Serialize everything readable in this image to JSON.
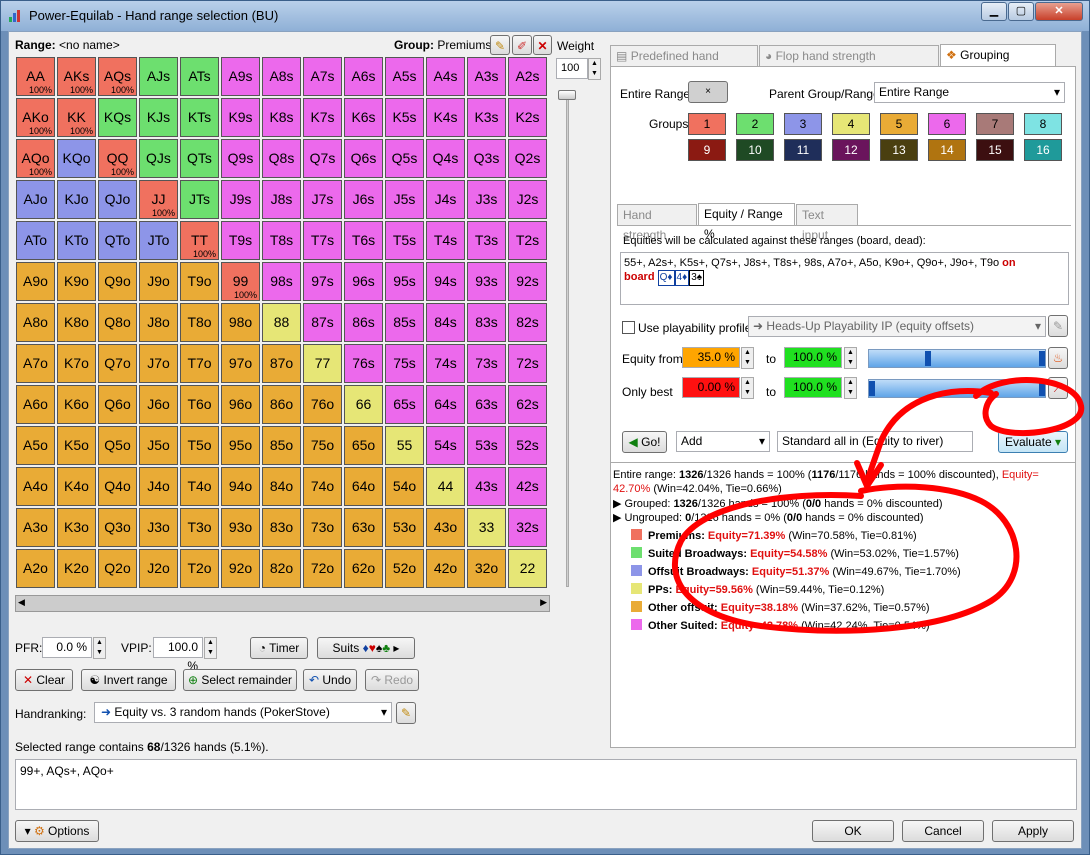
{
  "window": {
    "title": "Power-Equilab - Hand range selection (BU)"
  },
  "left": {
    "range_label": "Range:",
    "range_name": "<no name>",
    "group_label": "Group:",
    "group_name": "Premiums",
    "weight_label": "Weight",
    "weight_value": "100",
    "grid": [
      [
        [
          "AA",
          "1",
          "100%"
        ],
        [
          "AKs",
          "1",
          "100%"
        ],
        [
          "AQs",
          "1",
          "100%"
        ],
        [
          "AJs",
          "2",
          ""
        ],
        [
          "ATs",
          "2",
          ""
        ],
        [
          "A9s",
          "6",
          ""
        ],
        [
          "A8s",
          "6",
          ""
        ],
        [
          "A7s",
          "6",
          ""
        ],
        [
          "A6s",
          "6",
          ""
        ],
        [
          "A5s",
          "6",
          ""
        ],
        [
          "A4s",
          "6",
          ""
        ],
        [
          "A3s",
          "6",
          ""
        ],
        [
          "A2s",
          "6",
          ""
        ]
      ],
      [
        [
          "AKo",
          "1",
          "100%"
        ],
        [
          "KK",
          "1",
          "100%"
        ],
        [
          "KQs",
          "2",
          ""
        ],
        [
          "KJs",
          "2",
          ""
        ],
        [
          "KTs",
          "2",
          ""
        ],
        [
          "K9s",
          "6",
          ""
        ],
        [
          "K8s",
          "6",
          ""
        ],
        [
          "K7s",
          "6",
          ""
        ],
        [
          "K6s",
          "6",
          ""
        ],
        [
          "K5s",
          "6",
          ""
        ],
        [
          "K4s",
          "6",
          ""
        ],
        [
          "K3s",
          "6",
          ""
        ],
        [
          "K2s",
          "6",
          ""
        ]
      ],
      [
        [
          "AQo",
          "1",
          "100%"
        ],
        [
          "KQo",
          "3",
          ""
        ],
        [
          "QQ",
          "1",
          "100%"
        ],
        [
          "QJs",
          "2",
          ""
        ],
        [
          "QTs",
          "2",
          ""
        ],
        [
          "Q9s",
          "6",
          ""
        ],
        [
          "Q8s",
          "6",
          ""
        ],
        [
          "Q7s",
          "6",
          ""
        ],
        [
          "Q6s",
          "6",
          ""
        ],
        [
          "Q5s",
          "6",
          ""
        ],
        [
          "Q4s",
          "6",
          ""
        ],
        [
          "Q3s",
          "6",
          ""
        ],
        [
          "Q2s",
          "6",
          ""
        ]
      ],
      [
        [
          "AJo",
          "3",
          ""
        ],
        [
          "KJo",
          "3",
          ""
        ],
        [
          "QJo",
          "3",
          ""
        ],
        [
          "JJ",
          "1",
          "100%"
        ],
        [
          "JTs",
          "2",
          ""
        ],
        [
          "J9s",
          "6",
          ""
        ],
        [
          "J8s",
          "6",
          ""
        ],
        [
          "J7s",
          "6",
          ""
        ],
        [
          "J6s",
          "6",
          ""
        ],
        [
          "J5s",
          "6",
          ""
        ],
        [
          "J4s",
          "6",
          ""
        ],
        [
          "J3s",
          "6",
          ""
        ],
        [
          "J2s",
          "6",
          ""
        ]
      ],
      [
        [
          "ATo",
          "3",
          ""
        ],
        [
          "KTo",
          "3",
          ""
        ],
        [
          "QTo",
          "3",
          ""
        ],
        [
          "JTo",
          "3",
          ""
        ],
        [
          "TT",
          "1",
          "100%"
        ],
        [
          "T9s",
          "6",
          ""
        ],
        [
          "T8s",
          "6",
          ""
        ],
        [
          "T7s",
          "6",
          ""
        ],
        [
          "T6s",
          "6",
          ""
        ],
        [
          "T5s",
          "6",
          ""
        ],
        [
          "T4s",
          "6",
          ""
        ],
        [
          "T3s",
          "6",
          ""
        ],
        [
          "T2s",
          "6",
          ""
        ]
      ],
      [
        [
          "A9o",
          "5",
          ""
        ],
        [
          "K9o",
          "5",
          ""
        ],
        [
          "Q9o",
          "5",
          ""
        ],
        [
          "J9o",
          "5",
          ""
        ],
        [
          "T9o",
          "5",
          ""
        ],
        [
          "99",
          "1",
          "100%"
        ],
        [
          "98s",
          "6",
          ""
        ],
        [
          "97s",
          "6",
          ""
        ],
        [
          "96s",
          "6",
          ""
        ],
        [
          "95s",
          "6",
          ""
        ],
        [
          "94s",
          "6",
          ""
        ],
        [
          "93s",
          "6",
          ""
        ],
        [
          "92s",
          "6",
          ""
        ]
      ],
      [
        [
          "A8o",
          "5",
          ""
        ],
        [
          "K8o",
          "5",
          ""
        ],
        [
          "Q8o",
          "5",
          ""
        ],
        [
          "J8o",
          "5",
          ""
        ],
        [
          "T8o",
          "5",
          ""
        ],
        [
          "98o",
          "5",
          ""
        ],
        [
          "88",
          "4",
          ""
        ],
        [
          "87s",
          "6",
          ""
        ],
        [
          "86s",
          "6",
          ""
        ],
        [
          "85s",
          "6",
          ""
        ],
        [
          "84s",
          "6",
          ""
        ],
        [
          "83s",
          "6",
          ""
        ],
        [
          "82s",
          "6",
          ""
        ]
      ],
      [
        [
          "A7o",
          "5",
          ""
        ],
        [
          "K7o",
          "5",
          ""
        ],
        [
          "Q7o",
          "5",
          ""
        ],
        [
          "J7o",
          "5",
          ""
        ],
        [
          "T7o",
          "5",
          ""
        ],
        [
          "97o",
          "5",
          ""
        ],
        [
          "87o",
          "5",
          ""
        ],
        [
          "77",
          "4",
          ""
        ],
        [
          "76s",
          "6",
          ""
        ],
        [
          "75s",
          "6",
          ""
        ],
        [
          "74s",
          "6",
          ""
        ],
        [
          "73s",
          "6",
          ""
        ],
        [
          "72s",
          "6",
          ""
        ]
      ],
      [
        [
          "A6o",
          "5",
          ""
        ],
        [
          "K6o",
          "5",
          ""
        ],
        [
          "Q6o",
          "5",
          ""
        ],
        [
          "J6o",
          "5",
          ""
        ],
        [
          "T6o",
          "5",
          ""
        ],
        [
          "96o",
          "5",
          ""
        ],
        [
          "86o",
          "5",
          ""
        ],
        [
          "76o",
          "5",
          ""
        ],
        [
          "66",
          "4",
          ""
        ],
        [
          "65s",
          "6",
          ""
        ],
        [
          "64s",
          "6",
          ""
        ],
        [
          "63s",
          "6",
          ""
        ],
        [
          "62s",
          "6",
          ""
        ]
      ],
      [
        [
          "A5o",
          "5",
          ""
        ],
        [
          "K5o",
          "5",
          ""
        ],
        [
          "Q5o",
          "5",
          ""
        ],
        [
          "J5o",
          "5",
          ""
        ],
        [
          "T5o",
          "5",
          ""
        ],
        [
          "95o",
          "5",
          ""
        ],
        [
          "85o",
          "5",
          ""
        ],
        [
          "75o",
          "5",
          ""
        ],
        [
          "65o",
          "5",
          ""
        ],
        [
          "55",
          "4",
          ""
        ],
        [
          "54s",
          "6",
          ""
        ],
        [
          "53s",
          "6",
          ""
        ],
        [
          "52s",
          "6",
          ""
        ]
      ],
      [
        [
          "A4o",
          "5",
          ""
        ],
        [
          "K4o",
          "5",
          ""
        ],
        [
          "Q4o",
          "5",
          ""
        ],
        [
          "J4o",
          "5",
          ""
        ],
        [
          "T4o",
          "5",
          ""
        ],
        [
          "94o",
          "5",
          ""
        ],
        [
          "84o",
          "5",
          ""
        ],
        [
          "74o",
          "5",
          ""
        ],
        [
          "64o",
          "5",
          ""
        ],
        [
          "54o",
          "5",
          ""
        ],
        [
          "44",
          "4",
          ""
        ],
        [
          "43s",
          "6",
          ""
        ],
        [
          "42s",
          "6",
          ""
        ]
      ],
      [
        [
          "A3o",
          "5",
          ""
        ],
        [
          "K3o",
          "5",
          ""
        ],
        [
          "Q3o",
          "5",
          ""
        ],
        [
          "J3o",
          "5",
          ""
        ],
        [
          "T3o",
          "5",
          ""
        ],
        [
          "93o",
          "5",
          ""
        ],
        [
          "83o",
          "5",
          ""
        ],
        [
          "73o",
          "5",
          ""
        ],
        [
          "63o",
          "5",
          ""
        ],
        [
          "53o",
          "5",
          ""
        ],
        [
          "43o",
          "5",
          ""
        ],
        [
          "33",
          "4",
          ""
        ],
        [
          "32s",
          "6",
          ""
        ]
      ],
      [
        [
          "A2o",
          "5",
          ""
        ],
        [
          "K2o",
          "5",
          ""
        ],
        [
          "Q2o",
          "5",
          ""
        ],
        [
          "J2o",
          "5",
          ""
        ],
        [
          "T2o",
          "5",
          ""
        ],
        [
          "92o",
          "5",
          ""
        ],
        [
          "82o",
          "5",
          ""
        ],
        [
          "72o",
          "5",
          ""
        ],
        [
          "62o",
          "5",
          ""
        ],
        [
          "52o",
          "5",
          ""
        ],
        [
          "42o",
          "5",
          ""
        ],
        [
          "32o",
          "5",
          ""
        ],
        [
          "22",
          "4",
          ""
        ]
      ]
    ],
    "pfr_label": "PFR:",
    "pfr_value": "0.0 %",
    "vpip_label": "VPIP:",
    "vpip_value": "100.0 %",
    "timer": "Timer",
    "suits": "Suits",
    "clear": "Clear",
    "invert": "Invert range",
    "select_remainder": "Select remainder",
    "undo": "Undo",
    "redo": "Redo",
    "handranking_label": "Handranking:",
    "handranking_value": "Equity vs. 3 random hands (PokerStove)",
    "selected_text": "Selected range contains ",
    "selected_count": "68",
    "selected_rest": "/1326 hands (5.1%).",
    "range_text": "99+, AQs+, AQo+",
    "options": "Options"
  },
  "right": {
    "tabs": [
      "Predefined hand ranges",
      "Flop hand strength distribution",
      "Grouping options"
    ],
    "entire_range_label": "Entire Range:",
    "entire_range_btn": "×",
    "parent_label": "Parent Group/Range:",
    "parent_value": "Entire Range",
    "groups_label": "Groups:",
    "groups": [
      [
        "1",
        "#f0715f",
        "#000"
      ],
      [
        "2",
        "#6ddf6f",
        "#000"
      ],
      [
        "3",
        "#8d95e8",
        "#000"
      ],
      [
        "4",
        "#e6e676",
        "#000"
      ],
      [
        "5",
        "#e9ab36",
        "#000"
      ],
      [
        "6",
        "#ec69ec",
        "#000"
      ],
      [
        "7",
        "#a87a78",
        "#000"
      ],
      [
        "8",
        "#7ee3e3",
        "#000"
      ],
      [
        "9",
        "#8b1a12",
        "#fff"
      ],
      [
        "10",
        "#1f4a24",
        "#fff"
      ],
      [
        "11",
        "#1f2e5a",
        "#fff"
      ],
      [
        "12",
        "#6a145c",
        "#fff"
      ],
      [
        "13",
        "#4a3f10",
        "#fff"
      ],
      [
        "14",
        "#b07410",
        "#fff"
      ],
      [
        "15",
        "#3c0f10",
        "#fff"
      ],
      [
        "16",
        "#1f9a9a",
        "#fff"
      ]
    ],
    "subtabs": [
      "Hand strength",
      "Equity / Range %",
      "Text input"
    ],
    "equity_note": "Equities will be calculated against these ranges (board, dead):",
    "against_range": "55+, A2s+, K5s+, Q7s+, J8s+, T8s+, 98s, A7o+, A5o, K9o+, Q9o+, J9o+, T9o",
    "on": "on",
    "board": "board",
    "board_cards": [
      "Q♦",
      "4♦",
      "3♠"
    ],
    "playability_label": "Use playability profile:",
    "playability_value": "Heads-Up Playability IP  (equity offsets)",
    "equity_from_label": "Equity from",
    "equity_from": "35.0 %",
    "to": "to",
    "equity_to": "100.0 %",
    "only_best_label": "Only best",
    "only_best_from": "0.00 %",
    "only_best_to": "100.0 %",
    "go": "Go!",
    "mode": "Add",
    "standard": "Standard all in (Equity to river)",
    "evaluate": "Evaluate",
    "results": {
      "l1a": "Entire range: ",
      "l1b": "1326",
      "l1c": "/1326 hands = 100%  (",
      "l1d": "1176",
      "l1e": "/1176 hands = 100% discounted), ",
      "l1f": "Equity=",
      "l2a": "42.70%",
      "l2b": " (Win=42.04%, Tie=0.66%)",
      "l3a": "Grouped: ",
      "l3b": "1326",
      "l3c": "/1326 hands = 100%  (",
      "l3d": "0/0",
      "l3e": " hands = 0% discounted)",
      "l4a": "Ungrouped: ",
      "l4b": "0",
      "l4c": "/1326 hands = 0%  (",
      "l4d": "0/0",
      "l4e": " hands = 0% discounted)",
      "groups": [
        {
          "name": "Premiums:",
          "eq": "Equity=71.39%",
          "rest": " (Win=70.58%, Tie=0.81%)",
          "color": "#f0715f"
        },
        {
          "name": "Suited Broadways:",
          "eq": "Equity=54.58%",
          "rest": " (Win=53.02%, Tie=1.57%)",
          "color": "#6ddf6f"
        },
        {
          "name": "Offsuit Broadways:",
          "eq": "Equity=51.37%",
          "rest": " (Win=49.67%, Tie=1.70%)",
          "color": "#8d95e8"
        },
        {
          "name": "PPs:",
          "eq": "Equity=59.56%",
          "rest": " (Win=59.44%, Tie=0.12%)",
          "color": "#e6e676"
        },
        {
          "name": "Other offsuit:",
          "eq": "Equity=38.18%",
          "rest": " (Win=37.62%, Tie=0.57%)",
          "color": "#e9ab36"
        },
        {
          "name": "Other Suited:",
          "eq": "Equity=42.78%",
          "rest": " (Win=42.24%, Tie=0.54%)",
          "color": "#ec69ec"
        }
      ]
    }
  },
  "footer": {
    "ok": "OK",
    "cancel": "Cancel",
    "apply": "Apply"
  }
}
